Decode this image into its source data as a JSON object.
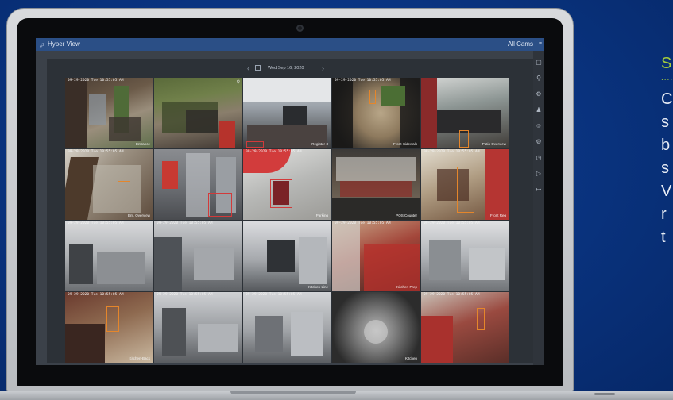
{
  "app": {
    "title": "Hyper View",
    "view_selector": "All Cams"
  },
  "viewer": {
    "date": "Wed Sep 16, 2020"
  },
  "toolbar_icons": [
    "monitor-icon",
    "search-icon",
    "pin-icon",
    "person-icon",
    "face-icon",
    "settings-icon",
    "clock-icon",
    "tag-icon",
    "logout-icon"
  ],
  "cameras": [
    {
      "ts": "09-29-2020 Tue 10:55:05 AM",
      "name": "Entrance"
    },
    {
      "ts": "",
      "name": "Register-3"
    },
    {
      "ts": "09-29-2020 Tue 10:55:05 AM",
      "name": "Front-Sidewalk"
    },
    {
      "ts": "",
      "name": "Patio Overview"
    },
    {
      "ts": "09-29-2020 Tue 10:55:05 AM",
      "name": "Ent. Overview"
    },
    {
      "ts": "",
      "name": ""
    },
    {
      "ts": "09-29-2020 Tue 10:55:05 AM",
      "name": "Parking"
    },
    {
      "ts": "",
      "name": "POS Counter"
    },
    {
      "ts": "09-29-2020 Tue 10:55:05 AM",
      "name": "Front Reg"
    },
    {
      "ts": "09-29-2020 Tue 10:55:05 AM",
      "name": ""
    },
    {
      "ts": "09-29-2020 Tue 10:55:05 AM",
      "name": ""
    },
    {
      "ts": "",
      "name": "Kitchen-Line"
    },
    {
      "ts": "09-29-2020 Tue 10:55:05 AM",
      "name": "Kitchen-Prep"
    },
    {
      "ts": "09-29-2020 Tue 10:55:05 AM",
      "name": ""
    },
    {
      "ts": "09-29-2020 Tue 10:55:05 AM",
      "name": "Kitchen-Back"
    },
    {
      "ts": "09-29-2020 Tue 10:55:05 AM",
      "name": ""
    },
    {
      "ts": "09-29-2020 Tue 10:55:05 AM",
      "name": ""
    },
    {
      "ts": "",
      "name": "Kitchen"
    },
    {
      "ts": "09-29-2020 Tue 10:55:05 AM",
      "name": ""
    },
    {
      "ts": "09-29-2020 Tue 10:55:05 AM",
      "name": ""
    }
  ],
  "side_copy": {
    "heading": "S",
    "dots": "........",
    "lines": [
      "C",
      "s",
      "b",
      "s",
      "V",
      "r",
      "t"
    ]
  },
  "colors": {
    "background": "#0a3583",
    "titlebar": "#2b4f86",
    "accent_green": "#a3cc3b",
    "detection_box": "#e5862b",
    "detection_red": "#d23a3a"
  }
}
